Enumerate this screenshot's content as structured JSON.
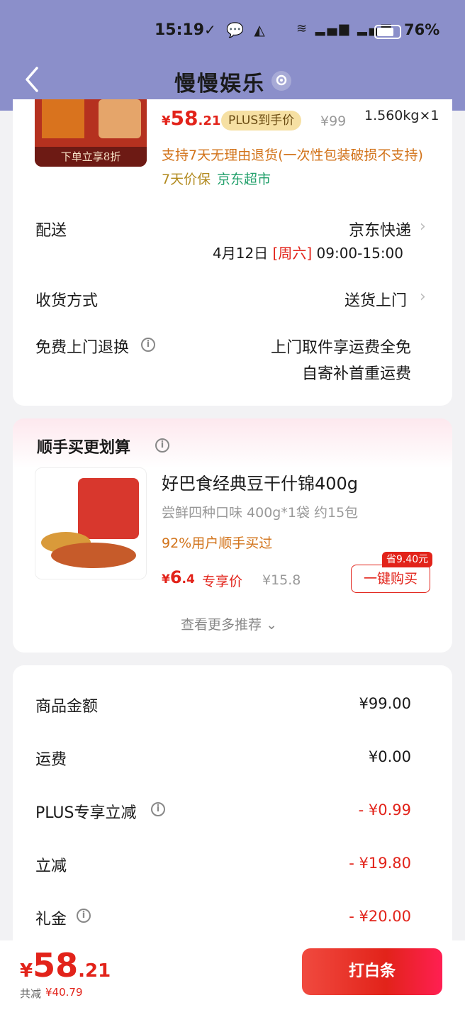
{
  "status_bar": {
    "time": "15:19",
    "battery": "76%",
    "battery_level": 0.76
  },
  "header": {
    "title": "慢慢娱乐"
  },
  "product": {
    "image_banner": "下单立享8折",
    "price_symbol": "¥",
    "price_int": "58",
    "price_dec": ".21",
    "plus_badge": "PLUS到手价",
    "original_price": "¥99",
    "weight": "1.560kg×1",
    "return_note": "支持7天无理由退货(一次性包装破损不支持)",
    "guarantee": "7天价保",
    "store": "京东超市"
  },
  "delivery": {
    "label": "配送",
    "carrier": "京东快递",
    "date": "4月12日",
    "weekday": "[周六]",
    "time_window": "09:00-15:00"
  },
  "receive": {
    "label": "收货方式",
    "value": "送货上门"
  },
  "free_return": {
    "label": "免费上门退换",
    "line1": "上门取件享运费全免",
    "line2": "自寄补首重运费"
  },
  "recommend": {
    "title": "顺手买更划算",
    "name": "好巴食经典豆干什锦400g",
    "desc": "尝鲜四种口味 400g*1袋 约15包",
    "percent": "92%用户顺手买过",
    "price_symbol": "¥",
    "price_int": "6",
    "price_dec": ".4",
    "tag": "专享价",
    "original_price": "¥15.8",
    "save_badge": "省9.40元",
    "buy_label": "一键购买",
    "more": "查看更多推荐"
  },
  "summary": [
    {
      "label": "商品金额",
      "value": "¥99.00",
      "red": false,
      "info": false
    },
    {
      "label": "运费",
      "value": "¥0.00",
      "red": false,
      "info": false
    },
    {
      "label": "PLUS专享立减",
      "value": "- ¥0.99",
      "red": true,
      "info": true
    },
    {
      "label": "立减",
      "value": "- ¥19.80",
      "red": true,
      "info": false
    },
    {
      "label": "礼金",
      "value": "- ¥20.00",
      "red": true,
      "info": true
    }
  ],
  "footer": {
    "price_symbol": "¥",
    "price_int": "58",
    "price_dec": ".21",
    "saved_label": "共减",
    "saved_value": "¥40.79",
    "pay_label": "打白条"
  }
}
